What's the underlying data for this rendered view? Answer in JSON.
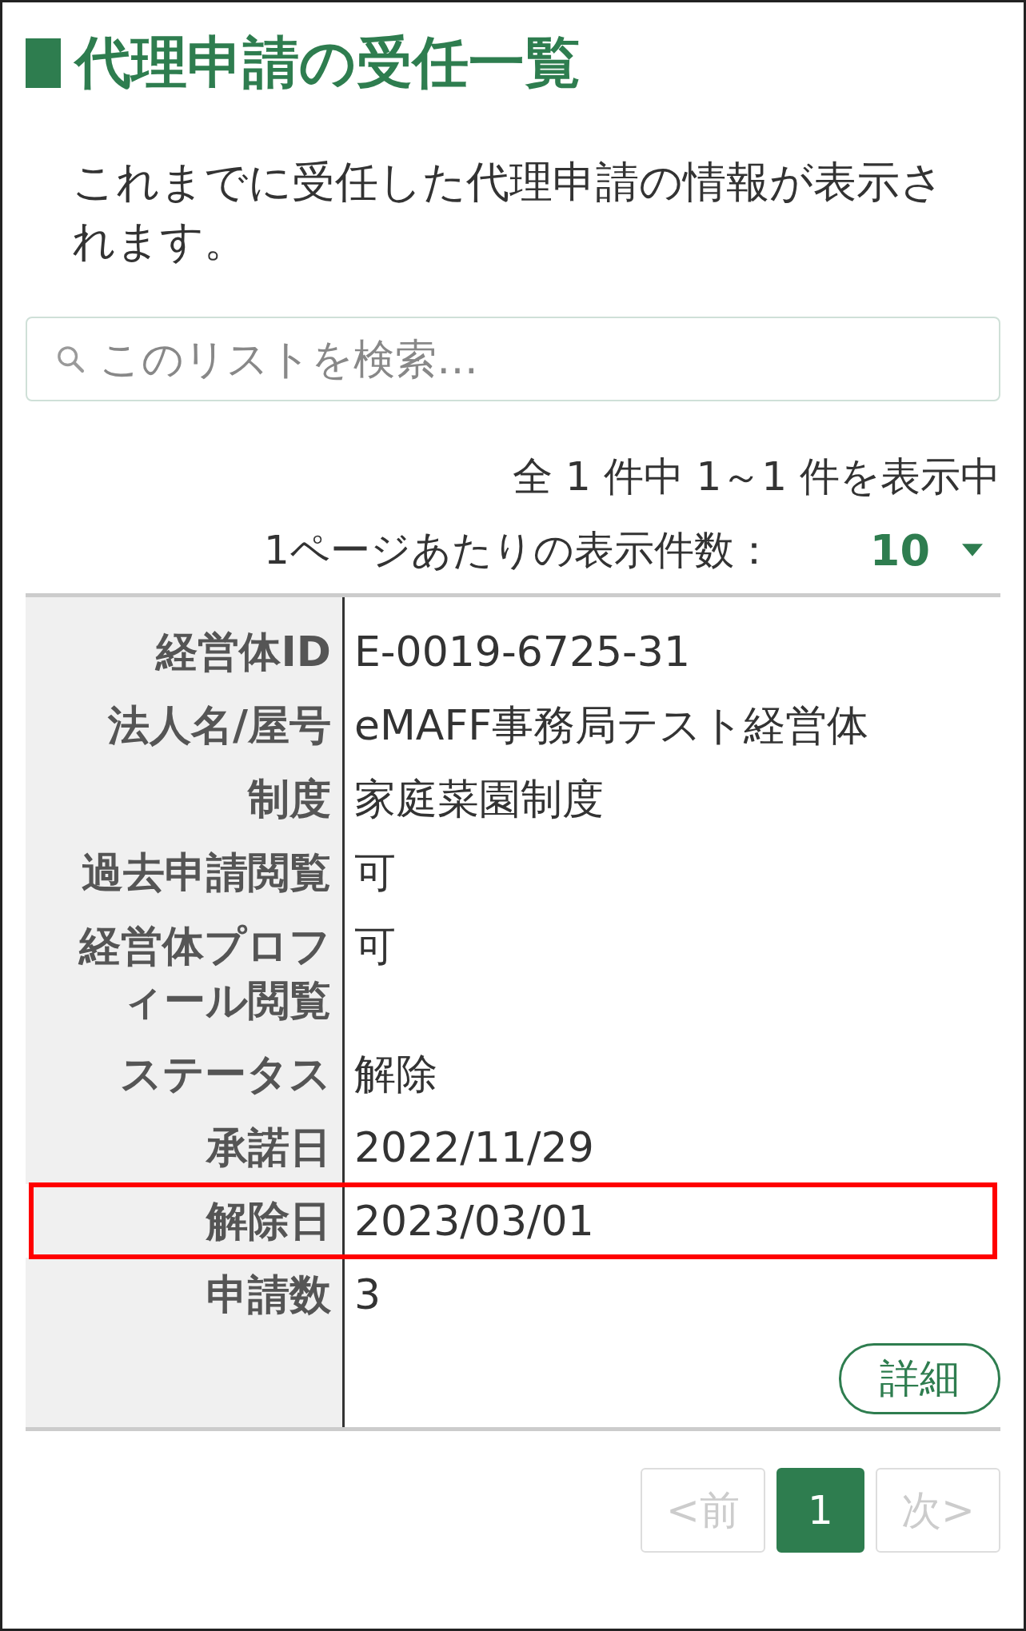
{
  "title": "代理申請の受任一覧",
  "description": "これまでに受任した代理申請の情報が表示されます。",
  "search": {
    "placeholder": "このリストを検索…"
  },
  "count_text": "全 1 件中 1～1 件を表示中",
  "per_page": {
    "label": "1ページあたりの表示件数：",
    "value": "10"
  },
  "record": {
    "rows": [
      {
        "label": "経営体ID",
        "value": "E-0019-6725-31",
        "highlighted": false
      },
      {
        "label": "法人名/屋号",
        "value": "eMAFF事務局テスト経営体",
        "highlighted": false
      },
      {
        "label": "制度",
        "value": "家庭菜園制度",
        "highlighted": false
      },
      {
        "label": "過去申請閲覧",
        "value": "可",
        "highlighted": false
      },
      {
        "label": "経営体プロフィール閲覧",
        "value": "可",
        "highlighted": false
      },
      {
        "label": "ステータス",
        "value": "解除",
        "highlighted": false
      },
      {
        "label": "承諾日",
        "value": "2022/11/29",
        "highlighted": false
      },
      {
        "label": "解除日",
        "value": "2023/03/01",
        "highlighted": true
      },
      {
        "label": "申請数",
        "value": "3",
        "highlighted": false
      }
    ],
    "button": "詳細"
  },
  "pagination": [
    {
      "label": "<前",
      "selected": false,
      "disabled": true
    },
    {
      "label": "1",
      "selected": true,
      "disabled": false
    },
    {
      "label": "次>",
      "selected": false,
      "disabled": true
    }
  ]
}
